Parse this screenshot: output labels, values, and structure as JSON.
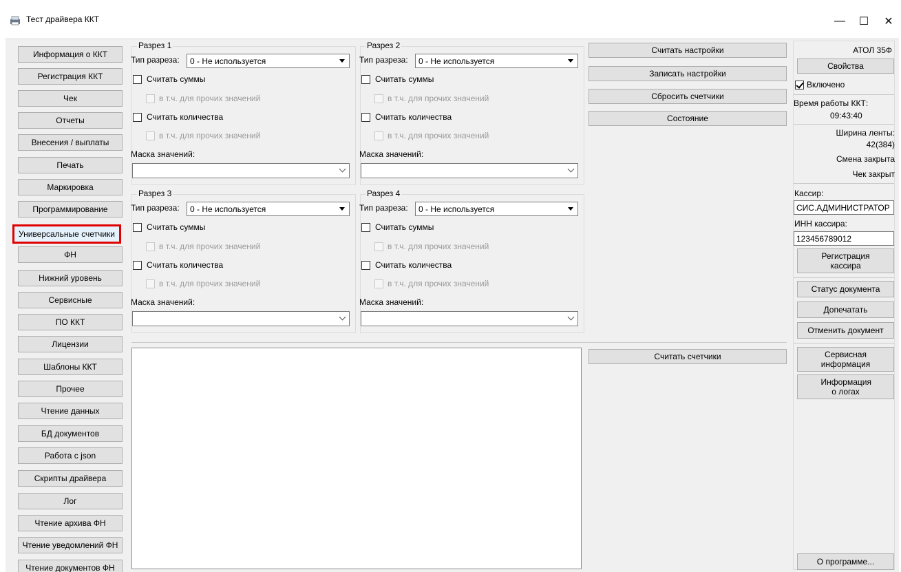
{
  "window": {
    "title": "Тест драйвера ККТ",
    "controls": {
      "minimize": "—",
      "maximize": "☐",
      "close": "✕"
    }
  },
  "sidebar": {
    "items": [
      "Информация о ККТ",
      "Регистрация ККТ",
      "Чек",
      "Отчеты",
      "Внесения / выплаты",
      "Печать",
      "Маркировка",
      "Программирование",
      "Универсальные счетчики",
      "ФН",
      "Нижний уровень",
      "Сервисные",
      "ПО ККТ",
      "Лицензии",
      "Шаблоны ККТ",
      "Прочее",
      "Чтение данных",
      "БД документов",
      "Работа с json",
      "Скрипты драйвера",
      "Лог",
      "Чтение архива ФН",
      "Чтение уведомлений ФН",
      "Чтение документов ФН"
    ],
    "active_index": 8
  },
  "sections": [
    {
      "title": "Разрез 1",
      "type_label": "Тип разреза:",
      "type_value": "0 - Не используется",
      "count_sums": "Считать суммы",
      "count_sums_other": "в т.ч. для прочих значений",
      "count_qty": "Считать количества",
      "count_qty_other": "в т.ч. для прочих значений",
      "mask_label": "Маска значений:",
      "mask_value": ""
    },
    {
      "title": "Разрез 2",
      "type_label": "Тип разреза:",
      "type_value": "0 - Не используется",
      "count_sums": "Считать суммы",
      "count_sums_other": "в т.ч. для прочих значений",
      "count_qty": "Считать количества",
      "count_qty_other": "в т.ч. для прочих значений",
      "mask_label": "Маска значений:",
      "mask_value": ""
    },
    {
      "title": "Разрез 3",
      "type_label": "Тип разреза:",
      "type_value": "0 - Не используется",
      "count_sums": "Считать суммы",
      "count_sums_other": "в т.ч. для прочих значений",
      "count_qty": "Считать количества",
      "count_qty_other": "в т.ч. для прочих значений",
      "mask_label": "Маска значений:",
      "mask_value": ""
    },
    {
      "title": "Разрез 4",
      "type_label": "Тип разреза:",
      "type_value": "0 - Не используется",
      "count_sums": "Считать суммы",
      "count_sums_other": "в т.ч. для прочих значений",
      "count_qty": "Считать количества",
      "count_qty_other": "в т.ч. для прочих значений",
      "mask_label": "Маска значений:",
      "mask_value": ""
    }
  ],
  "actions": {
    "read_settings": "Считать настройки",
    "write_settings": "Записать настройки",
    "reset_counters": "Сбросить счетчики",
    "state": "Состояние",
    "read_counters": "Считать счетчики"
  },
  "right_panel": {
    "model": "АТОЛ 35Ф",
    "properties": "Свойства",
    "enabled_label": "Включено",
    "enabled": true,
    "uptime_label": "Время работы ККТ:",
    "uptime_value": "09:43:40",
    "tape_width_label": "Ширина ленты:",
    "tape_width_value": "42(384)",
    "shift_state": "Смена закрыта",
    "receipt_state": "Чек закрыт",
    "cashier_label": "Кассир:",
    "cashier_value": "СИС.АДМИНИСТРАТОР",
    "cashier_inn_label": "ИНН кассира:",
    "cashier_inn_value": "123456789012",
    "register_cashier": "Регистрация кассира",
    "doc_status": "Статус документа",
    "reprint": "Допечатать",
    "cancel_doc": "Отменить документ",
    "service_info": "Сервисная информация",
    "log_info": "Информация о логах",
    "about": "О программе..."
  },
  "colors": {
    "client_bg": "#f0f0f0",
    "button_bg": "#e1e1e1",
    "button_border": "#adadad",
    "highlight": "#e00000",
    "disabled_text": "#9a9a9a"
  }
}
